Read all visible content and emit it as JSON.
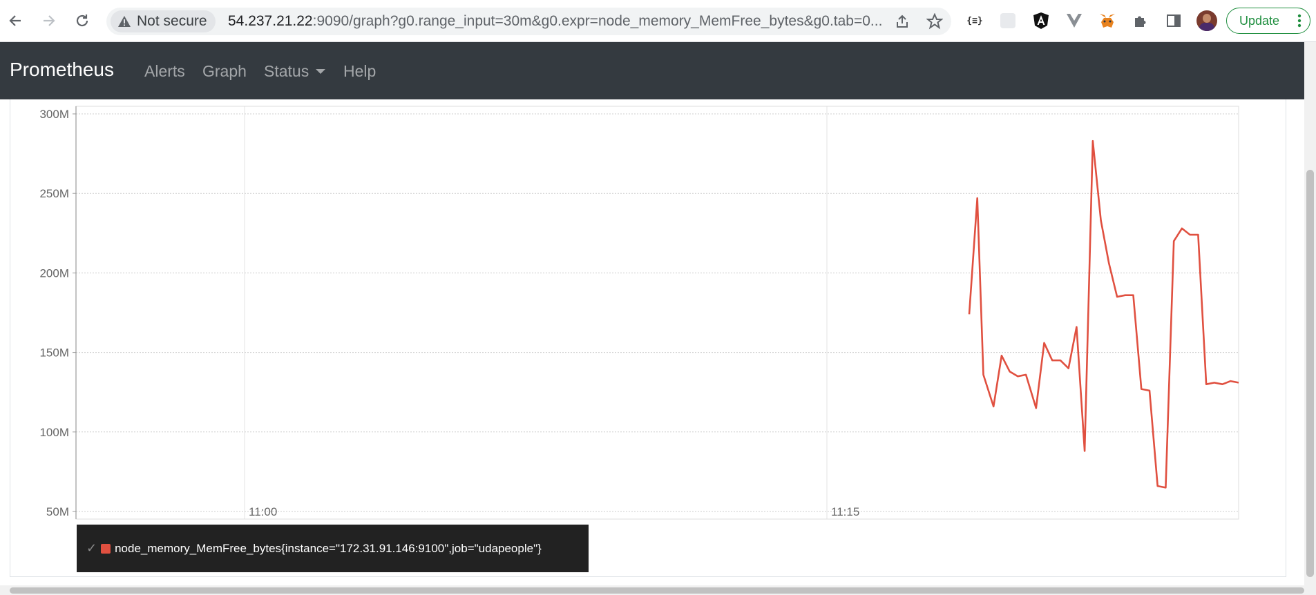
{
  "browser": {
    "security_label": "Not secure",
    "url_host": "54.237.21.22",
    "url_rest": ":9090/graph?g0.range_input=30m&g0.expr=node_memory_MemFree_bytes&g0.tab=0...",
    "update_label": "Update"
  },
  "navbar": {
    "brand": "Prometheus",
    "links": [
      "Alerts",
      "Graph",
      "Status",
      "Help"
    ]
  },
  "chart_data": {
    "type": "line",
    "y_ticks": [
      "300M",
      "250M",
      "200M",
      "150M",
      "100M",
      "50M"
    ],
    "x_ticks": [
      "11:00",
      "11:15"
    ],
    "ylim": [
      50,
      300
    ],
    "y_unit": "M",
    "grid": true,
    "series": [
      {
        "name": "node_memory_MemFree_bytes{instance=\"172.31.91.146:9100\",job=\"udapeople\"}",
        "color": "#e05040",
        "x": [
          0,
          0.4,
          0.7,
          1.2,
          1.6,
          2.0,
          2.4,
          2.8,
          3.3,
          3.7,
          4.1,
          4.5,
          4.9,
          5.3,
          5.7,
          6.1,
          6.5,
          6.9,
          7.3,
          7.7,
          8.1,
          8.5,
          8.9,
          9.3,
          9.7,
          10.1,
          10.5,
          10.9,
          11.3,
          11.7,
          12.1,
          12.5,
          12.9,
          13.3
        ],
        "values": [
          174,
          247,
          136,
          116,
          148,
          138,
          135,
          136,
          115,
          156,
          145,
          145,
          140,
          166,
          88,
          283,
          233,
          206,
          185,
          186,
          186,
          127,
          126,
          66,
          65,
          220,
          228,
          224,
          224,
          130,
          131,
          130,
          132,
          131
        ]
      }
    ]
  },
  "legend": {
    "check": "✓"
  }
}
